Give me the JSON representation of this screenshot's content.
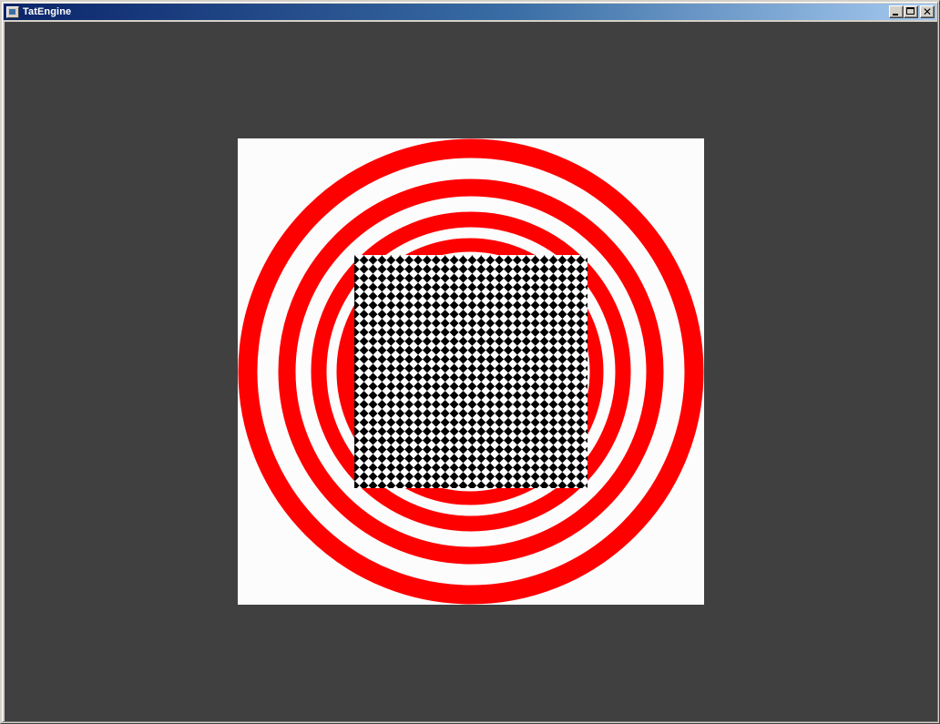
{
  "window": {
    "title": "TatEngine",
    "icon": "app-window-icon",
    "controls": {
      "minimize": "minimize-icon",
      "maximize": "maximize-icon",
      "close": "close-icon",
      "close_glyph": "✕"
    }
  },
  "scene": {
    "background_color": "#404040",
    "quad_color": "#ffffff",
    "ring_color": "#ff0000",
    "checker_colors": [
      "#000000",
      "#ffffff"
    ]
  }
}
